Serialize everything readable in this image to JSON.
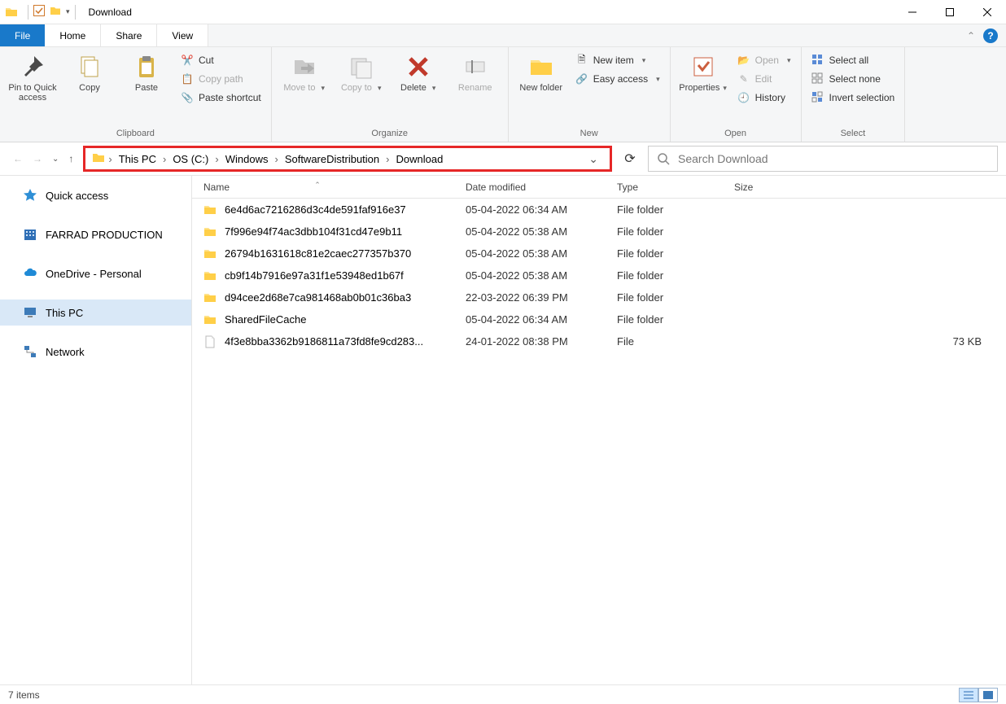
{
  "window": {
    "title": "Download"
  },
  "tabs": {
    "file": "File",
    "home": "Home",
    "share": "Share",
    "view": "View"
  },
  "ribbon": {
    "clipboard": {
      "label": "Clipboard",
      "pin": "Pin to Quick access",
      "copy": "Copy",
      "paste": "Paste",
      "cut": "Cut",
      "copy_path": "Copy path",
      "paste_shortcut": "Paste shortcut"
    },
    "organize": {
      "label": "Organize",
      "move_to": "Move to",
      "copy_to": "Copy to",
      "delete": "Delete",
      "rename": "Rename"
    },
    "new": {
      "label": "New",
      "new_folder": "New folder",
      "new_item": "New item",
      "easy_access": "Easy access"
    },
    "open": {
      "label": "Open",
      "properties": "Properties",
      "open_btn": "Open",
      "edit": "Edit",
      "history": "History"
    },
    "select": {
      "label": "Select",
      "select_all": "Select all",
      "select_none": "Select none",
      "invert": "Invert selection"
    }
  },
  "breadcrumb": {
    "items": [
      "This PC",
      "OS (C:)",
      "Windows",
      "SoftwareDistribution",
      "Download"
    ]
  },
  "search": {
    "placeholder": "Search Download"
  },
  "sidebar": {
    "quick_access": "Quick access",
    "farrad": "FARRAD PRODUCTION",
    "onedrive": "OneDrive - Personal",
    "this_pc": "This PC",
    "network": "Network"
  },
  "columns": {
    "name": "Name",
    "date": "Date modified",
    "type": "Type",
    "size": "Size"
  },
  "rows": [
    {
      "icon": "folder",
      "name": "6e4d6ac7216286d3c4de591faf916e37",
      "date": "05-04-2022 06:34 AM",
      "type": "File folder",
      "size": ""
    },
    {
      "icon": "folder",
      "name": "7f996e94f74ac3dbb104f31cd47e9b11",
      "date": "05-04-2022 05:38 AM",
      "type": "File folder",
      "size": ""
    },
    {
      "icon": "folder",
      "name": "26794b1631618c81e2caec277357b370",
      "date": "05-04-2022 05:38 AM",
      "type": "File folder",
      "size": ""
    },
    {
      "icon": "folder",
      "name": "cb9f14b7916e97a31f1e53948ed1b67f",
      "date": "05-04-2022 05:38 AM",
      "type": "File folder",
      "size": ""
    },
    {
      "icon": "folder",
      "name": "d94cee2d68e7ca981468ab0b01c36ba3",
      "date": "22-03-2022 06:39 PM",
      "type": "File folder",
      "size": ""
    },
    {
      "icon": "folder",
      "name": "SharedFileCache",
      "date": "05-04-2022 06:34 AM",
      "type": "File folder",
      "size": ""
    },
    {
      "icon": "file",
      "name": "4f3e8bba3362b9186811a73fd8fe9cd283...",
      "date": "24-01-2022 08:38 PM",
      "type": "File",
      "size": "73 KB"
    }
  ],
  "status": {
    "items": "7 items"
  }
}
